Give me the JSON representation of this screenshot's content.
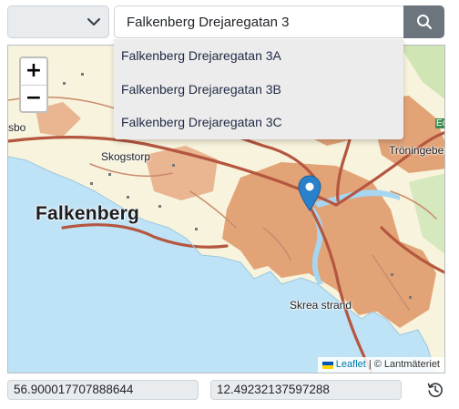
{
  "search": {
    "value": "Falkenberg Drejaregatan 3",
    "suggestions": [
      {
        "label": "Falkenberg Drejaregatan 3A"
      },
      {
        "label": "Falkenberg Drejaregatan 3B"
      },
      {
        "label": "Falkenberg Drejaregatan 3C"
      }
    ]
  },
  "map": {
    "zoom_in": "+",
    "zoom_out": "−",
    "places": {
      "falkenberg": "Falkenberg",
      "skogstorp": "Skogstorp",
      "skrea_strand": "Skrea strand",
      "troningeberg": "Tröningeber",
      "sbo": "sbo",
      "eo": "Eo"
    },
    "attribution": {
      "leaflet": "Leaflet",
      "separator": "|",
      "copyright": "© Lantmäteriet"
    },
    "colors": {
      "water": "#bfe3f6",
      "land": "#f7f3dc",
      "urban": "#e2a377",
      "road": "#b5563f",
      "marker": "#2a81cb"
    }
  },
  "coordinates": {
    "lat": "56.900017707888644",
    "lon": "12.49232137597288"
  },
  "icons": {
    "select": "chevron-down-icon",
    "search": "search-icon",
    "history": "history-icon",
    "marker": "map-marker-icon"
  }
}
